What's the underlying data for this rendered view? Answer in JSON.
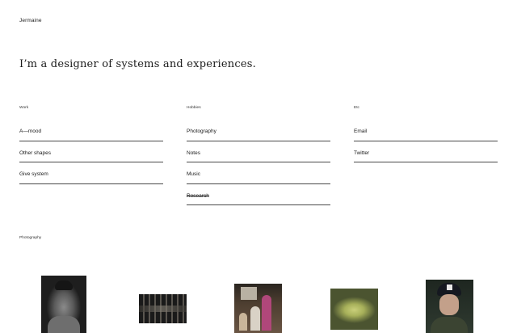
{
  "site": {
    "name": "Jermaine"
  },
  "headline": "I’m a designer of systems and experiences.",
  "columns": [
    {
      "title": "Work",
      "items": [
        "A—mood",
        "Other shapes",
        "Give system"
      ]
    },
    {
      "title": "Hobbies",
      "items": [
        "Photography",
        "Notes",
        "Music",
        "Research"
      ]
    },
    {
      "title": "Etc",
      "items": [
        "Email",
        "Twitter"
      ]
    }
  ],
  "photography": {
    "title": "Photography"
  }
}
